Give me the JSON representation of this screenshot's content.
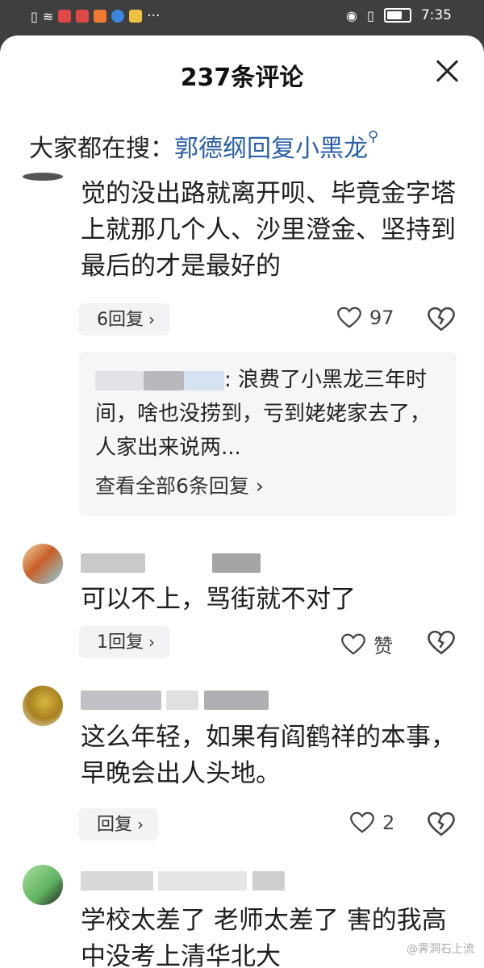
{
  "status_bar": {
    "time": "7:35"
  },
  "sheet": {
    "title": "237条评论"
  },
  "search": {
    "prefix": "大家都在搜：",
    "keyword": "郭德纲回复小黑龙"
  },
  "comments": [
    {
      "text": "觉的没出路就离开呗、毕竟金字塔上就那几个人、沙里澄金、坚持到最后的才是最好的",
      "reply_label": "6回复",
      "likes": "97",
      "preview_reply": ": 浪费了小黑龙三年时间，啥也没捞到，亏到姥姥家去了，人家出来说两...",
      "view_all": "查看全部6条回复"
    },
    {
      "text": "可以不上，骂街就不对了",
      "reply_label": "1回复",
      "likes": "赞"
    },
    {
      "text": "这么年轻，如果有阎鹤祥的本事，早晚会出人头地。",
      "reply_label": "回复",
      "likes": "2"
    },
    {
      "text": "学校太差了 老师太差了 害的我高中没考上清华北大"
    }
  ],
  "watermark": "@霁洞石上流"
}
